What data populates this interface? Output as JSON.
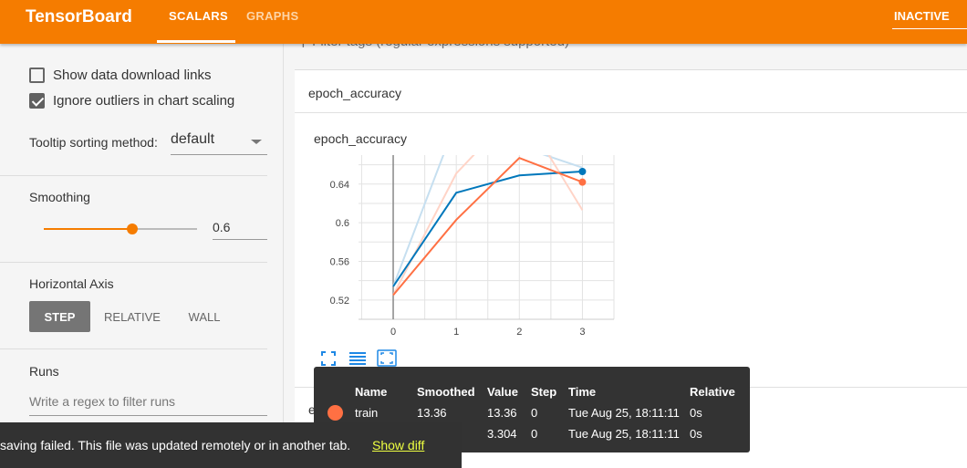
{
  "header": {
    "brand": "TensorBoard",
    "tabs": [
      {
        "label": "SCALARS",
        "active": true
      },
      {
        "label": "GRAPHS",
        "active": false
      }
    ],
    "status": "INACTIVE",
    "color": "#f57c00"
  },
  "sidebar": {
    "show_download_label": "Show data download links",
    "show_download_checked": false,
    "ignore_outliers_label": "Ignore outliers in chart scaling",
    "ignore_outliers_checked": true,
    "tooltip_sort_label": "Tooltip sorting method:",
    "tooltip_sort_value": "default",
    "smoothing_label": "Smoothing",
    "smoothing_value": "0.6",
    "smoothing_fraction": 0.6,
    "horizontal_axis_label": "Horizontal Axis",
    "axis_options": [
      "STEP",
      "RELATIVE",
      "WALL"
    ],
    "axis_selected": "STEP",
    "runs_label": "Runs",
    "runs_placeholder": "Write a regex to filter runs"
  },
  "main": {
    "filter_placeholder": "Filter tags (regular expressions supported)",
    "group_title": "epoch_accuracy",
    "chart_title": "epoch_accuracy",
    "second_group_title": "epoch_loss"
  },
  "chart_data": {
    "type": "line",
    "title": "epoch_accuracy",
    "x": [
      0,
      1,
      2,
      3
    ],
    "xlim": [
      -0.55,
      3.5
    ],
    "ylim": [
      0.5,
      0.67
    ],
    "x_ticks": [
      "0",
      "1",
      "2",
      "3"
    ],
    "y_ticks": [
      "0.52",
      "0.56",
      "0.6",
      "0.64"
    ],
    "y_tick_values": [
      0.52,
      0.56,
      0.6,
      0.64
    ],
    "grid": true,
    "series": [
      {
        "color": "#0077bb",
        "raw_color": "#c6dff0",
        "smoothed": [
          0.534,
          0.631,
          0.649,
          0.653
        ],
        "raw": [
          0.534,
          0.705,
          0.679,
          0.657
        ]
      },
      {
        "color": "#ff7043",
        "raw_color": "#ffd4c7",
        "smoothed": [
          0.525,
          0.603,
          0.667,
          0.642
        ],
        "raw": [
          0.525,
          0.651,
          0.72,
          0.613
        ]
      }
    ]
  },
  "chart_tools": [
    "expand-icon",
    "data-table-icon",
    "fit-domain-icon"
  ],
  "tooltip": {
    "headers": [
      "Name",
      "Smoothed",
      "Value",
      "Step",
      "Time",
      "Relative"
    ],
    "rows": [
      {
        "name": "train",
        "smoothed": "13.36",
        "value": "13.36",
        "step": "0",
        "time": "Tue Aug 25, 18:11:11",
        "relative": "0s",
        "color": "#ff7043"
      },
      {
        "name": "",
        "smoothed": "",
        "value": "3.304",
        "step": "0",
        "time": "Tue Aug 25, 18:11:11",
        "relative": "0s"
      }
    ]
  },
  "toast": {
    "message": "saving failed. This file was updated remotely or in another tab.",
    "action": "Show diff"
  }
}
